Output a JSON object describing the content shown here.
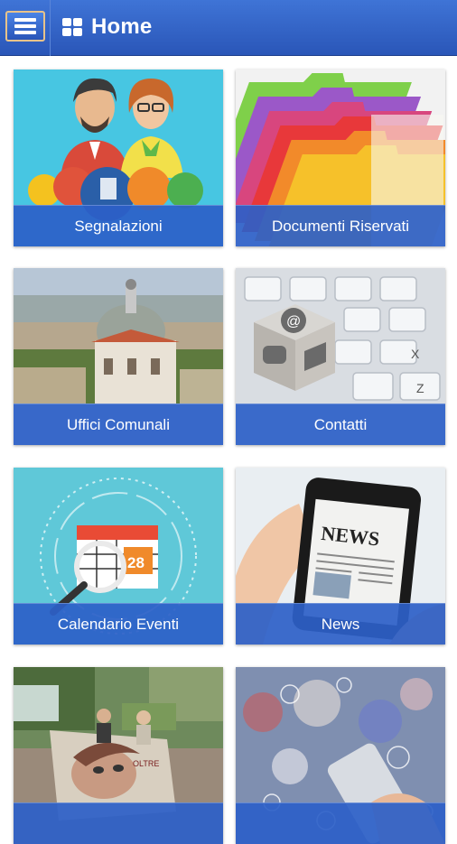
{
  "header": {
    "title": "Home",
    "menu_icon": "hamburger-menu-icon",
    "home_icon": "grid-home-icon"
  },
  "tiles": [
    {
      "label": "Segnalazioni",
      "image": "citizens-report-illustration"
    },
    {
      "label": "Documenti Riservati",
      "image": "colored-file-folders"
    },
    {
      "label": "Uffici Comunali",
      "image": "town-cathedral-photo"
    },
    {
      "label": "Contatti",
      "image": "keyboard-contact-cube"
    },
    {
      "label": "Calendario Eventi",
      "image": "calendar-magnifier-illustration"
    },
    {
      "label": "News",
      "image": "smartphone-newspaper"
    },
    {
      "label": "",
      "image": "street-art-event-photo"
    },
    {
      "label": "",
      "image": "smartphone-social-bokeh"
    }
  ],
  "colors": {
    "header": "#2f5fc4",
    "tile_label_bg": "#2d5fc8",
    "menu_border": "#e8c38a"
  }
}
